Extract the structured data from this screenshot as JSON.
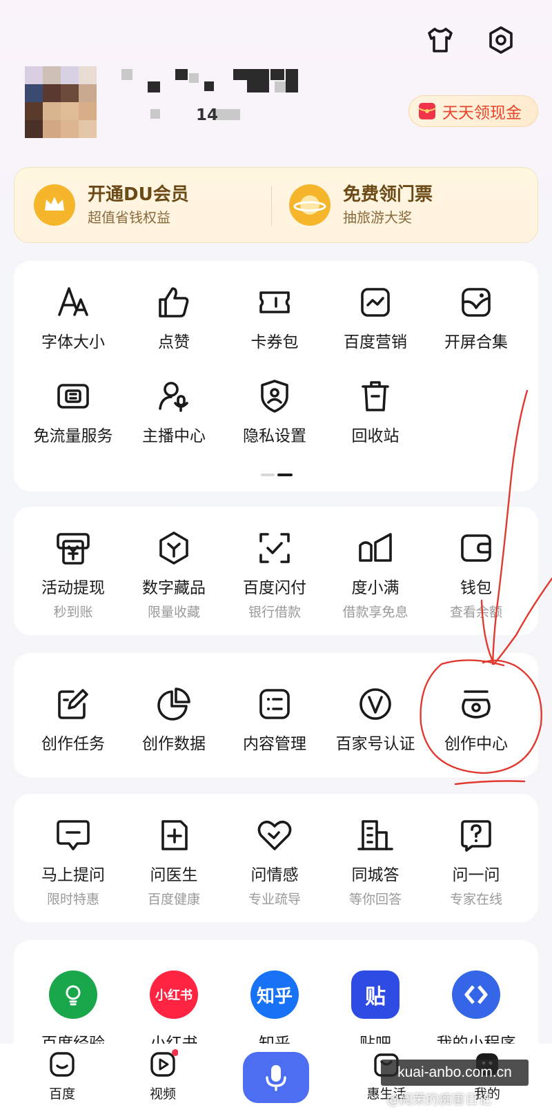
{
  "profile": {
    "id_visible": "14"
  },
  "cash_button": {
    "label": "天天领现金"
  },
  "vip_banner": {
    "left": {
      "title": "开通DU会员",
      "sub": "超值省钱权益"
    },
    "right": {
      "title": "免费领门票",
      "sub": "抽旅游大奖"
    }
  },
  "tools": [
    {
      "label": "字体大小",
      "icon": "font-size-icon"
    },
    {
      "label": "点赞",
      "icon": "thumbs-up-icon"
    },
    {
      "label": "卡券包",
      "icon": "ticket-icon"
    },
    {
      "label": "百度营销",
      "icon": "marketing-icon"
    },
    {
      "label": "开屏合集",
      "icon": "splash-icon"
    },
    {
      "label": "免流量服务",
      "icon": "data-free-icon"
    },
    {
      "label": "主播中心",
      "icon": "anchor-icon"
    },
    {
      "label": "隐私设置",
      "icon": "privacy-shield-icon"
    },
    {
      "label": "回收站",
      "icon": "trash-icon"
    }
  ],
  "finance": [
    {
      "label": "活动提现",
      "sub": "秒到账"
    },
    {
      "label": "数字藏品",
      "sub": "限量收藏"
    },
    {
      "label": "百度闪付",
      "sub": "银行借款"
    },
    {
      "label": "度小满",
      "sub": "借款享免息"
    },
    {
      "label": "钱包",
      "sub": "查看余额"
    }
  ],
  "creator": [
    {
      "label": "创作任务"
    },
    {
      "label": "创作数据"
    },
    {
      "label": "内容管理"
    },
    {
      "label": "百家号认证"
    },
    {
      "label": "创作中心"
    }
  ],
  "qa": [
    {
      "label": "马上提问",
      "sub": "限时特惠"
    },
    {
      "label": "问医生",
      "sub": "百度健康"
    },
    {
      "label": "问情感",
      "sub": "专业疏导"
    },
    {
      "label": "同城答",
      "sub": "等你回答"
    },
    {
      "label": "问一问",
      "sub": "专家在线"
    }
  ],
  "apps": [
    {
      "label": "百度经验",
      "color": "#1aa64b",
      "text": ""
    },
    {
      "label": "小红书",
      "color": "#ff2442",
      "text": "小红书"
    },
    {
      "label": "知乎",
      "color": "#1772f6",
      "text": "知乎"
    },
    {
      "label": "贴吧",
      "color": "#2e4ce3",
      "text": "贴"
    },
    {
      "label": "我的小程序",
      "color": "#3566e8",
      "text": ""
    }
  ],
  "bottom_nav": [
    {
      "label": "百度"
    },
    {
      "label": "视频"
    },
    {
      "label": "惠生活"
    },
    {
      "label": "我的"
    }
  ],
  "watermark": {
    "line1": "kuai-anbo.com.cn",
    "line2": "@阅荣的痴害日记"
  },
  "colors": {
    "accent_blue": "#4e6ef2",
    "cash_red": "#e8452c",
    "vip_brown": "#6b4a18",
    "annotation_red": "#e0392f"
  }
}
